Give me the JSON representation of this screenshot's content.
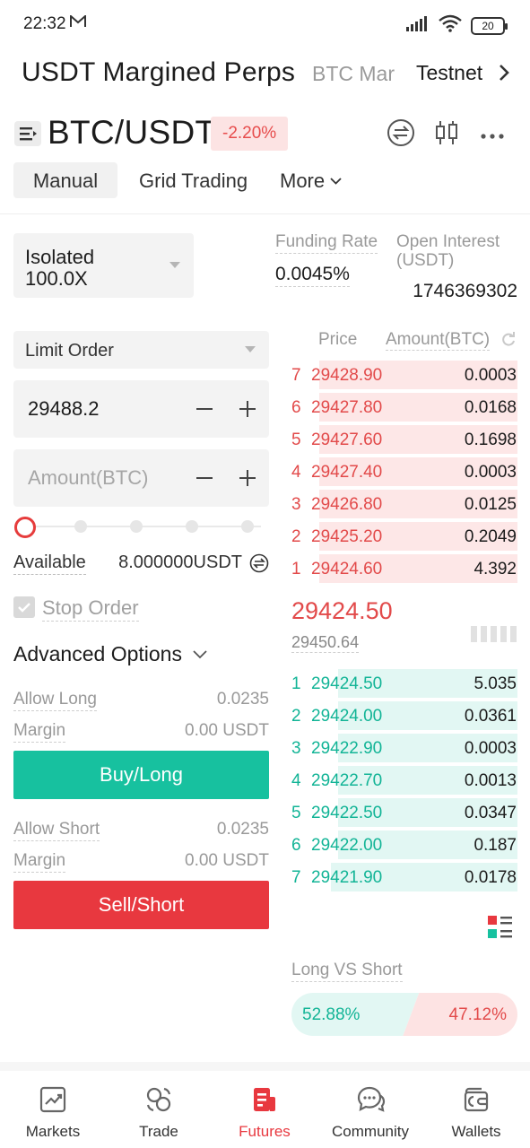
{
  "status_bar": {
    "time": "22:32",
    "battery": "20"
  },
  "top_nav": {
    "title": "USDT Margined Perps",
    "tabs": [
      "BTC Mar",
      "Testnet"
    ]
  },
  "pair": {
    "name": "BTC/USDT",
    "change": "-2.20%"
  },
  "modes": {
    "manual": "Manual",
    "grid": "Grid Trading",
    "more": "More"
  },
  "form": {
    "margin_mode": "Isolated",
    "leverage": "100.0X",
    "order_type": "Limit Order",
    "price_value": "29488.2",
    "amount_placeholder": "Amount(BTC)",
    "slider_level": 0,
    "available_label": "Available",
    "available_value": "8.000000USDT",
    "stop_order_label": "Stop Order",
    "advanced_label": "Advanced Options",
    "allow_long_label": "Allow Long",
    "allow_long_value": "0.0235",
    "margin_label": "Margin",
    "margin_long_value": "0.00 USDT",
    "buy_label": "Buy/Long",
    "allow_short_label": "Allow Short",
    "allow_short_value": "0.0235",
    "margin_short_value": "0.00 USDT",
    "sell_label": "Sell/Short"
  },
  "market_info": {
    "funding_label": "Funding Rate",
    "funding_value": "0.0045%",
    "oi_label": "Open Interest (USDT)",
    "oi_value": "1746369302"
  },
  "orderbook": {
    "price_header": "Price",
    "amount_header": "Amount(BTC)",
    "asks": [
      {
        "idx": "7",
        "price": "29428.90",
        "amount": "0.0003",
        "depth": 0.82
      },
      {
        "idx": "6",
        "price": "29427.80",
        "amount": "0.0168",
        "depth": 0.82
      },
      {
        "idx": "5",
        "price": "29427.60",
        "amount": "0.1698",
        "depth": 0.82
      },
      {
        "idx": "4",
        "price": "29427.40",
        "amount": "0.0003",
        "depth": 0.82
      },
      {
        "idx": "3",
        "price": "29426.80",
        "amount": "0.0125",
        "depth": 0.82
      },
      {
        "idx": "2",
        "price": "29425.20",
        "amount": "0.2049",
        "depth": 0.82
      },
      {
        "idx": "1",
        "price": "29424.60",
        "amount": "4.392",
        "depth": 0.82
      }
    ],
    "last_price": "29424.50",
    "mark_price": "29450.64",
    "bids": [
      {
        "idx": "1",
        "price": "29424.50",
        "amount": "5.035",
        "depth": 0.74
      },
      {
        "idx": "2",
        "price": "29424.00",
        "amount": "0.0361",
        "depth": 0.74
      },
      {
        "idx": "3",
        "price": "29422.90",
        "amount": "0.0003",
        "depth": 0.74
      },
      {
        "idx": "4",
        "price": "29422.70",
        "amount": "0.0013",
        "depth": 0.74
      },
      {
        "idx": "5",
        "price": "29422.50",
        "amount": "0.0347",
        "depth": 0.74
      },
      {
        "idx": "6",
        "price": "29422.00",
        "amount": "0.187",
        "depth": 0.74
      },
      {
        "idx": "7",
        "price": "29421.90",
        "amount": "0.0178",
        "depth": 0.77
      }
    ]
  },
  "long_short": {
    "label": "Long VS Short",
    "long_pct": "52.88%",
    "short_pct": "47.12%",
    "long_fraction": 0.5288
  },
  "bottom_nav": {
    "items": [
      {
        "label": "Markets",
        "icon": "chart-icon"
      },
      {
        "label": "Trade",
        "icon": "exchange-icon"
      },
      {
        "label": "Futures",
        "icon": "futures-icon"
      },
      {
        "label": "Community",
        "icon": "chat-icon"
      },
      {
        "label": "Wallets",
        "icon": "wallet-icon"
      }
    ],
    "active_index": 2
  },
  "colors": {
    "buy": "#17c19f",
    "sell": "#e8383f",
    "ask_text": "#e24a4a",
    "bid_text": "#12b496",
    "ask_bg": "#fde7e7",
    "bid_bg": "#e2f7f3"
  }
}
